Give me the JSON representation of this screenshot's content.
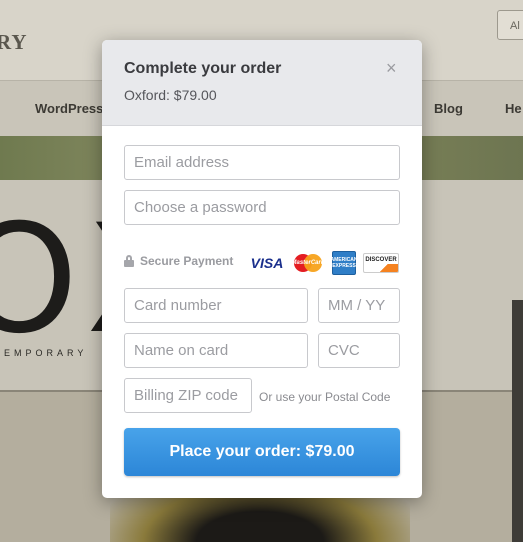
{
  "background": {
    "logo": "RY",
    "corner_button": "Al",
    "nav": [
      "WordPress",
      "Blog",
      "He"
    ],
    "hero_text": "OX D",
    "tagline": "EMPORARY"
  },
  "modal": {
    "title": "Complete your order",
    "subtitle": "Oxford: $79.00",
    "close_icon": "×",
    "email": {
      "placeholder": "Email address",
      "value": ""
    },
    "password": {
      "placeholder": "Choose a password",
      "value": ""
    },
    "secure_label": "Secure Payment",
    "cards": [
      "VISA",
      "MasterCard",
      "AMERICAN EXPRESS",
      "DISCOVER"
    ],
    "card_number": {
      "placeholder": "Card number",
      "value": ""
    },
    "expiry": {
      "placeholder": "MM / YY",
      "value": ""
    },
    "name_on_card": {
      "placeholder": "Name on card",
      "value": ""
    },
    "cvc": {
      "placeholder": "CVC",
      "value": ""
    },
    "zip": {
      "placeholder": "Billing ZIP code",
      "value": ""
    },
    "zip_hint": "Or use your Postal Code",
    "submit_label": "Place your order: $79.00"
  },
  "colors": {
    "accent": "#2c86d7",
    "overlay": "#8a8578"
  }
}
